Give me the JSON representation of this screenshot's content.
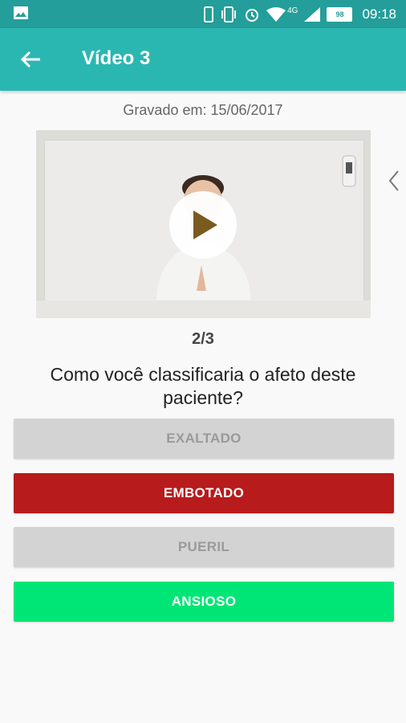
{
  "status_bar": {
    "time": "09:18",
    "network_label": "4G",
    "battery_label": "98",
    "icons": [
      "image-icon",
      "phone-icon",
      "vibrate-icon",
      "alarm-icon",
      "wifi-icon",
      "signal-icon",
      "battery-icon"
    ]
  },
  "app_bar": {
    "title": "Vídeo 3",
    "back_icon": "arrow-left-icon"
  },
  "recorded_label": "Gravado em: 15/06/2017",
  "progress": "2/3",
  "question": "Como você classificaria o afeto deste paciente?",
  "options": [
    {
      "label": "EXALTADO",
      "state": "disabled"
    },
    {
      "label": "EMBOTADO",
      "state": "wrong"
    },
    {
      "label": "PUERIL",
      "state": "disabled"
    },
    {
      "label": "ANSIOSO",
      "state": "correct"
    }
  ],
  "colors": {
    "status_bar": "#249e9a",
    "app_bar": "#2bb7b1",
    "disabled_bg": "#d3d3d3",
    "disabled_text": "#9a9a9a",
    "wrong_bg": "#b71b1c",
    "correct_bg": "#00e676",
    "option_text": "#ffffff"
  }
}
